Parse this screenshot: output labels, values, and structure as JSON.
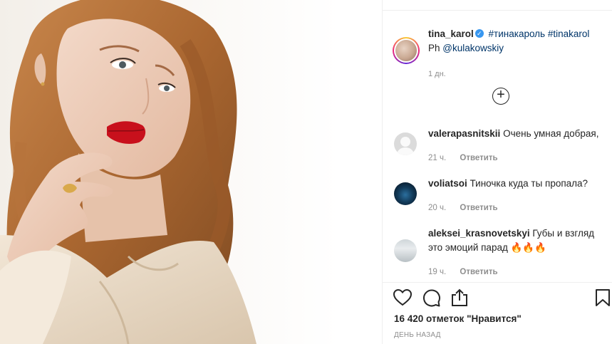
{
  "photo": {
    "alt": ""
  },
  "post": {
    "author": {
      "username": "tina_karol",
      "verified_icon": "verified-badge-icon"
    },
    "caption": {
      "tag1": "#тинакароль",
      "tag2": "#tinakarol",
      "line2_prefix": "Ph",
      "mention": "@kulakowskiy"
    },
    "time": "1 дн.",
    "load_more_icon": "plus-circle-icon"
  },
  "comments": [
    {
      "username": "valerapasnitskii",
      "text": "Очень умная добрая,",
      "line2": "",
      "time": "21 ч.",
      "reply_label": "Ответить",
      "avatar": "default-avatar"
    },
    {
      "username": "voliatsoi",
      "text": "Тиночка куда ты пропала?",
      "line2": "",
      "time": "20 ч.",
      "reply_label": "Ответить",
      "avatar": "wolf-avatar"
    },
    {
      "username": "aleksei_krasnovetskyi",
      "text": "Губы и взгляд",
      "line2": "это эмоций парад 🔥🔥🔥",
      "time": "19 ч.",
      "reply_label": "Ответить",
      "avatar": "group-avatar"
    }
  ],
  "actions": {
    "like_icon": "heart-icon",
    "comment_icon": "comment-icon",
    "share_icon": "share-icon",
    "save_icon": "bookmark-icon"
  },
  "likes_text": "16 420 отметок \"Нравится\"",
  "date_text": "ДЕНЬ НАЗАД",
  "colors": {
    "text": "#262626",
    "muted": "#8e8e8e",
    "link": "#003569",
    "verified": "#3897f0",
    "divider": "#efefef"
  }
}
